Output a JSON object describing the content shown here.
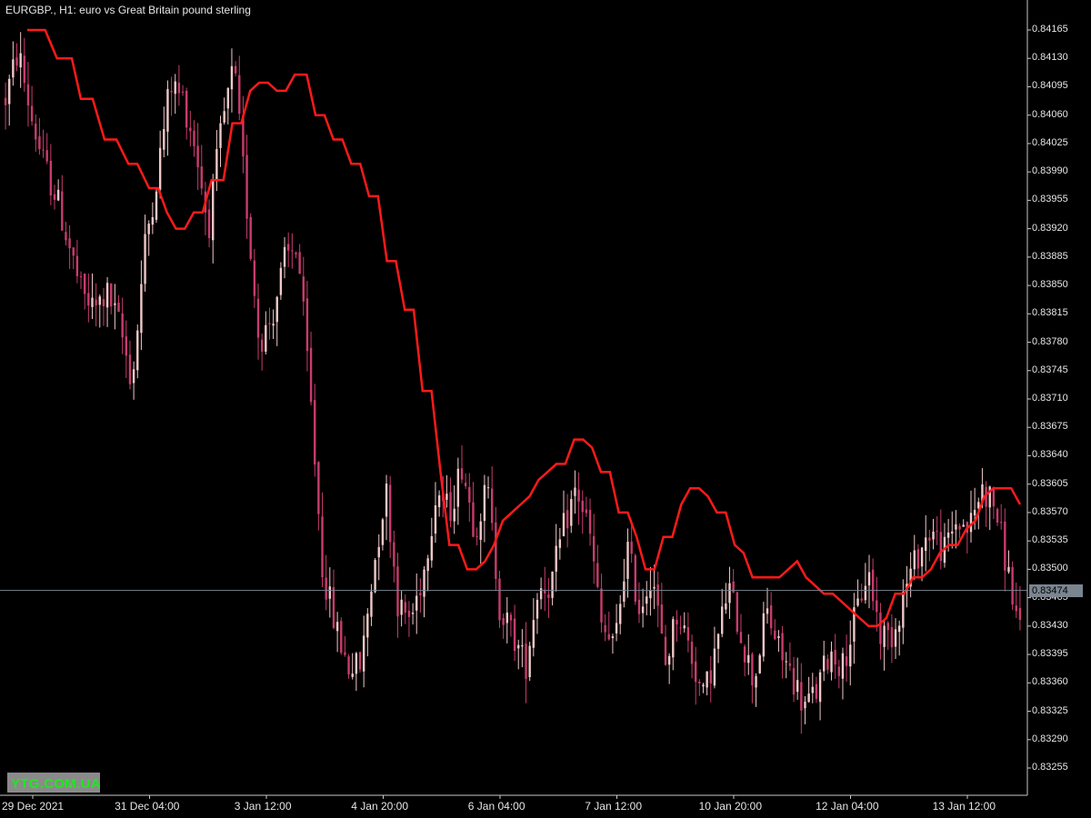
{
  "header": {
    "title": "EURGBP., H1:  euro vs Great Britain pound sterling"
  },
  "colors": {
    "background": "#000000",
    "axis": "#c8c8c8",
    "text": "#e6e6e6",
    "bull_candle": "#f0c8c8",
    "bear_candle": "#c83c6e",
    "indicator_line": "#ff1a1a",
    "current_price_line": "#7a8590",
    "current_price_bg": "#7a8590",
    "watermark_bg": "#8a8a8a",
    "watermark_text": "#22e622"
  },
  "current_price": "0.83474",
  "watermark": "YTG.COM.UA",
  "chart_data": {
    "type": "candlestick",
    "symbol": "EURGBP.",
    "timeframe": "H1",
    "ylim": [
      0.8323,
      0.8419
    ],
    "y_ticks": [
      0.84165,
      0.8413,
      0.84095,
      0.8406,
      0.84025,
      0.8399,
      0.83955,
      0.8392,
      0.83885,
      0.8385,
      0.83815,
      0.8378,
      0.83745,
      0.8371,
      0.83675,
      0.8364,
      0.83605,
      0.8357,
      0.83535,
      0.835,
      0.83465,
      0.8343,
      0.83395,
      0.8336,
      0.83325,
      0.8329,
      0.83255
    ],
    "y_tick_labels": [
      "0.84165",
      "0.84130",
      "0.84095",
      "0.84060",
      "0.84025",
      "0.83990",
      "0.83955",
      "0.83920",
      "0.83885",
      "0.83850",
      "0.83815",
      "0.83780",
      "0.83745",
      "0.83710",
      "0.83675",
      "0.83640",
      "0.83605",
      "0.83570",
      "0.83535",
      "0.83500",
      "0.83465",
      "0.83430",
      "0.83395",
      "0.83360",
      "0.83325",
      "0.83290",
      "0.83255"
    ],
    "x_labels": [
      "29 Dec 2021",
      "31 Dec 04:00",
      "3 Jan 12:00",
      "4 Jan 20:00",
      "6 Jan 04:00",
      "7 Jan 12:00",
      "10 Jan 20:00",
      "12 Jan 04:00",
      "13 Jan 12:00"
    ],
    "current_price_value": 0.83474,
    "close_path": [
      0.8408,
      0.8414,
      0.8406,
      0.84,
      0.8396,
      0.839,
      0.8384,
      0.8382,
      0.8384,
      0.838,
      0.8373,
      0.839,
      0.8399,
      0.841,
      0.8408,
      0.8402,
      0.8392,
      0.8404,
      0.8412,
      0.8395,
      0.8378,
      0.8381,
      0.8388,
      0.839,
      0.8372,
      0.835,
      0.8343,
      0.8338,
      0.8338,
      0.835,
      0.836,
      0.8345,
      0.8344,
      0.835,
      0.836,
      0.8357,
      0.8363,
      0.8355,
      0.836,
      0.8345,
      0.8342,
      0.8338,
      0.8348,
      0.8348,
      0.8355,
      0.836,
      0.8355,
      0.8343,
      0.834,
      0.8353,
      0.8345,
      0.835,
      0.8338,
      0.8345,
      0.834,
      0.8334,
      0.834,
      0.8348,
      0.8342,
      0.8336,
      0.8345,
      0.834,
      0.8337,
      0.8333,
      0.8335,
      0.834,
      0.8338,
      0.8344,
      0.835,
      0.8342,
      0.8342,
      0.8348,
      0.8352,
      0.8355,
      0.8352,
      0.8356,
      0.8355,
      0.836,
      0.8358,
      0.835,
      0.8342
    ],
    "ma_line": [
      [
        0.0,
        0.84165
      ],
      [
        0.003,
        0.84165
      ],
      [
        0.006,
        0.84165
      ],
      [
        0.01,
        0.8413
      ],
      [
        0.015,
        0.8413
      ],
      [
        0.018,
        0.8408
      ],
      [
        0.022,
        0.8408
      ],
      [
        0.026,
        0.8403
      ],
      [
        0.03,
        0.8403
      ],
      [
        0.034,
        0.84
      ],
      [
        0.037,
        0.84
      ],
      [
        0.041,
        0.8397
      ],
      [
        0.044,
        0.8397
      ],
      [
        0.047,
        0.8394
      ],
      [
        0.05,
        0.8392
      ],
      [
        0.053,
        0.8392
      ],
      [
        0.056,
        0.8394
      ],
      [
        0.059,
        0.8394
      ],
      [
        0.062,
        0.8398
      ],
      [
        0.066,
        0.8398
      ],
      [
        0.069,
        0.8405
      ],
      [
        0.072,
        0.8405
      ],
      [
        0.075,
        0.8409
      ],
      [
        0.078,
        0.841
      ],
      [
        0.081,
        0.841
      ],
      [
        0.084,
        0.8409
      ],
      [
        0.087,
        0.8409
      ],
      [
        0.09,
        0.8411
      ],
      [
        0.094,
        0.8411
      ],
      [
        0.097,
        0.8406
      ],
      [
        0.1,
        0.8406
      ],
      [
        0.103,
        0.8403
      ],
      [
        0.106,
        0.8403
      ],
      [
        0.109,
        0.84
      ],
      [
        0.112,
        0.84
      ],
      [
        0.115,
        0.8396
      ],
      [
        0.118,
        0.8396
      ],
      [
        0.121,
        0.8388
      ],
      [
        0.124,
        0.8388
      ],
      [
        0.127,
        0.8382
      ],
      [
        0.13,
        0.8382
      ],
      [
        0.133,
        0.8372
      ],
      [
        0.136,
        0.8372
      ],
      [
        0.139,
        0.8362
      ],
      [
        0.142,
        0.8353
      ],
      [
        0.145,
        0.8353
      ],
      [
        0.148,
        0.835
      ],
      [
        0.151,
        0.835
      ],
      [
        0.154,
        0.8351
      ],
      [
        0.157,
        0.8353
      ],
      [
        0.16,
        0.8356
      ],
      [
        0.163,
        0.8357
      ],
      [
        0.166,
        0.8358
      ],
      [
        0.169,
        0.8359
      ],
      [
        0.172,
        0.8361
      ],
      [
        0.175,
        0.8362
      ],
      [
        0.178,
        0.8363
      ],
      [
        0.181,
        0.8363
      ],
      [
        0.184,
        0.8366
      ],
      [
        0.187,
        0.8366
      ],
      [
        0.19,
        0.8365
      ],
      [
        0.193,
        0.8362
      ],
      [
        0.196,
        0.8362
      ],
      [
        0.199,
        0.8357
      ],
      [
        0.202,
        0.8357
      ],
      [
        0.205,
        0.8354
      ],
      [
        0.208,
        0.835
      ],
      [
        0.211,
        0.835
      ],
      [
        0.214,
        0.8354
      ],
      [
        0.217,
        0.8354
      ],
      [
        0.22,
        0.8358
      ],
      [
        0.223,
        0.836
      ],
      [
        0.226,
        0.836
      ],
      [
        0.229,
        0.8359
      ],
      [
        0.232,
        0.8357
      ],
      [
        0.235,
        0.8357
      ],
      [
        0.238,
        0.8353
      ],
      [
        0.241,
        0.8352
      ],
      [
        0.244,
        0.8349
      ],
      [
        0.247,
        0.8349
      ],
      [
        0.25,
        0.8349
      ],
      [
        0.253,
        0.8349
      ],
      [
        0.256,
        0.835
      ],
      [
        0.259,
        0.8351
      ],
      [
        0.262,
        0.8349
      ],
      [
        0.265,
        0.8348
      ],
      [
        0.268,
        0.8347
      ],
      [
        0.271,
        0.8347
      ],
      [
        0.274,
        0.8346
      ],
      [
        0.277,
        0.8345
      ],
      [
        0.28,
        0.8344
      ],
      [
        0.283,
        0.8343
      ],
      [
        0.286,
        0.8343
      ],
      [
        0.289,
        0.8344
      ],
      [
        0.292,
        0.8347
      ],
      [
        0.295,
        0.8347
      ],
      [
        0.298,
        0.8349
      ],
      [
        0.301,
        0.8349
      ],
      [
        0.304,
        0.835
      ],
      [
        0.307,
        0.8352
      ],
      [
        0.31,
        0.8353
      ],
      [
        0.313,
        0.8353
      ],
      [
        0.316,
        0.8355
      ],
      [
        0.319,
        0.8356
      ],
      [
        0.322,
        0.8359
      ],
      [
        0.325,
        0.836
      ],
      [
        0.328,
        0.836
      ],
      [
        0.331,
        0.836
      ],
      [
        0.334,
        0.8358
      ]
    ]
  }
}
